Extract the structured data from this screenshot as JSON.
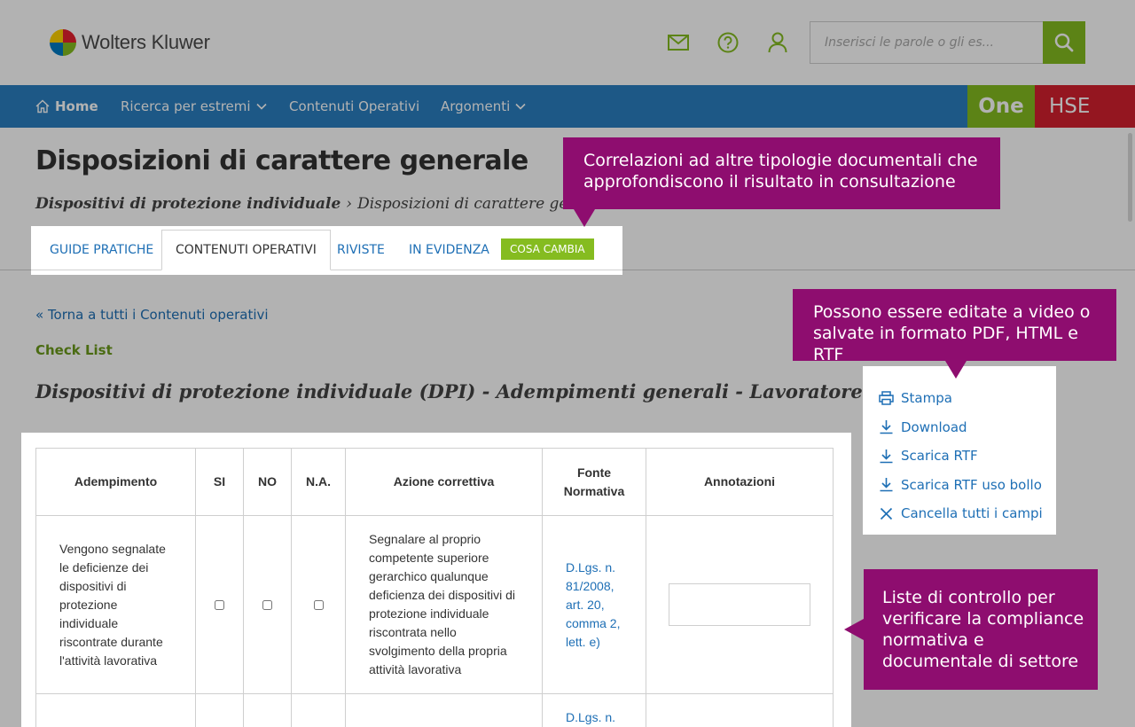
{
  "header": {
    "logo_text": "Wolters Kluwer",
    "icons": [
      "mail-icon",
      "help-icon",
      "user-icon"
    ],
    "search": {
      "placeholder": "Inserisci le parole o gli es..."
    }
  },
  "nav": {
    "items": [
      {
        "label": "Home",
        "icon": "home-icon"
      },
      {
        "label": "Ricerca per estremi",
        "has_dropdown": true
      },
      {
        "label": "Contenuti Operativi"
      },
      {
        "label": "Argomenti",
        "has_dropdown": true
      }
    ],
    "brand_one": "One",
    "brand_hse": "HSE"
  },
  "page": {
    "title": "Disposizioni di carattere generale",
    "breadcrumb": {
      "parent": "Dispositivi di protezione individuale",
      "separator": "›",
      "current": "Disposizioni di carattere generale"
    }
  },
  "tabs": {
    "items": [
      {
        "label": "GUIDE PRATICHE",
        "active": false
      },
      {
        "label": "CONTENUTI OPERATIVI",
        "active": true
      },
      {
        "label": "RIVISTE",
        "active": false
      },
      {
        "label": "IN EVIDENZA",
        "active": false
      }
    ],
    "badge": "COSA CAMBIA"
  },
  "content": {
    "back_link": "« Torna a tutti i Contenuti operativi",
    "section_label": "Check List",
    "doc_title": "Dispositivi di protezione individuale (DPI) - Adempimenti generali - Lavoratore"
  },
  "actions": [
    {
      "label": "Stampa",
      "icon": "print-icon"
    },
    {
      "label": "Download",
      "icon": "download-icon"
    },
    {
      "label": "Scarica RTF",
      "icon": "download-icon"
    },
    {
      "label": "Scarica RTF uso bollo",
      "icon": "download-icon"
    },
    {
      "label": "Cancella tutti i campi",
      "icon": "close-icon"
    }
  ],
  "table": {
    "headers": [
      "Adempimento",
      "SI",
      "NO",
      "N.A.",
      "Azione correttiva",
      "Fonte Normativa",
      "Annotazioni"
    ],
    "rows": [
      {
        "adempimento": "Vengono segnalate le deficienze dei dispositivi di protezione individuale riscontrate durante l'attività lavorativa",
        "azione": "Segnalare al proprio competente superiore gerarchico qualunque deficienza dei dispositivi di protezione individuale riscontrata nello svolgimento della propria attività lavorativa",
        "fonte": "D.Lgs. n. 81/2008, art. 20, comma 2, lett. e)"
      },
      {
        "adempimento": "",
        "azione": "",
        "fonte": "D.Lgs. n."
      }
    ]
  },
  "callouts": {
    "tabs": "Correlazioni ad altre tipologie documentali che approfondiscono il risultato in consultazione",
    "actions": "Possono essere editate a video o salvate in formato PDF, HTML e RTF",
    "table": "Liste di controllo per verificare la compliance normativa e documentale di settore"
  },
  "colors": {
    "nav_blue": "#2a7fc0",
    "brand_green": "#85bc20",
    "brand_red": "#d4202f",
    "callout_purple": "#8e0d6f",
    "link_blue": "#1e6fb5"
  }
}
